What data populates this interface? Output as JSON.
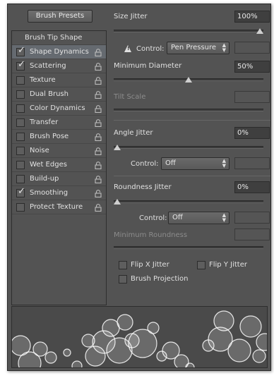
{
  "toolbar": {
    "presets_label": "Brush Presets"
  },
  "left_list": {
    "header": "Brush Tip Shape",
    "items": [
      {
        "label": "Shape Dynamics",
        "checked": true,
        "selected": true
      },
      {
        "label": "Scattering",
        "checked": true,
        "selected": false
      },
      {
        "label": "Texture",
        "checked": false,
        "selected": false
      },
      {
        "label": "Dual Brush",
        "checked": false,
        "selected": false
      },
      {
        "label": "Color Dynamics",
        "checked": false,
        "selected": false
      },
      {
        "label": "Transfer",
        "checked": false,
        "selected": false
      },
      {
        "label": "Brush Pose",
        "checked": false,
        "selected": false
      },
      {
        "label": "Noise",
        "checked": false,
        "selected": false
      },
      {
        "label": "Wet Edges",
        "checked": false,
        "selected": false
      },
      {
        "label": "Build-up",
        "checked": false,
        "selected": false
      },
      {
        "label": "Smoothing",
        "checked": true,
        "selected": false
      },
      {
        "label": "Protect Texture",
        "checked": false,
        "selected": false
      }
    ]
  },
  "size_jitter": {
    "label": "Size Jitter",
    "value": "100%",
    "level": 1.0
  },
  "size_control": {
    "label": "Control:",
    "value": "Pen Pressure"
  },
  "min_diameter": {
    "label": "Minimum Diameter",
    "value": "50%",
    "level": 0.5
  },
  "tilt_scale": {
    "label": "Tilt Scale",
    "value": ""
  },
  "angle_jitter": {
    "label": "Angle Jitter",
    "value": "0%",
    "level": 0.0
  },
  "angle_control": {
    "label": "Control:",
    "value": "Off"
  },
  "roundness_jitter": {
    "label": "Roundness Jitter",
    "value": "0%",
    "level": 0.0
  },
  "roundness_control": {
    "label": "Control:",
    "value": "Off"
  },
  "min_roundness": {
    "label": "Minimum Roundness",
    "value": ""
  },
  "flip_x": {
    "label": "Flip X Jitter",
    "checked": false
  },
  "flip_y": {
    "label": "Flip Y Jitter",
    "checked": false
  },
  "brush_projection": {
    "label": "Brush Projection",
    "checked": false
  },
  "icons": {
    "lock": "lock-icon",
    "warning": "warning-icon",
    "check": "check-icon",
    "select_arrows": "updown-arrows-icon"
  },
  "colors": {
    "panel_bg": "#535353",
    "selected_row": "#656a70",
    "field_bg": "#3f3f3f",
    "text": "#e0e0e0"
  }
}
